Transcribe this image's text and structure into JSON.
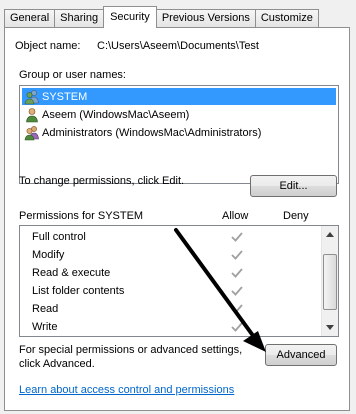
{
  "tabs": [
    "General",
    "Sharing",
    "Security",
    "Previous Versions",
    "Customize"
  ],
  "active_tab": "Security",
  "object": {
    "label": "Object name:",
    "value": "C:\\Users\\Aseem\\Documents\\Test"
  },
  "groups": {
    "label": "Group or user names:",
    "items": [
      {
        "label": "SYSTEM",
        "icon": "users-icon",
        "selected": true
      },
      {
        "label": "Aseem (WindowsMac\\Aseem)",
        "icon": "user-icon",
        "selected": false
      },
      {
        "label": "Administrators (WindowsMac\\Administrators)",
        "icon": "users-icon",
        "selected": false
      }
    ]
  },
  "change_text": "To change permissions, click Edit.",
  "edit_label": "Edit...",
  "permissions": {
    "title": "Permissions for SYSTEM",
    "allow_header": "Allow",
    "deny_header": "Deny",
    "rows": [
      {
        "name": "Full control",
        "allow": true,
        "deny": false
      },
      {
        "name": "Modify",
        "allow": true,
        "deny": false
      },
      {
        "name": "Read & execute",
        "allow": true,
        "deny": false
      },
      {
        "name": "List folder contents",
        "allow": true,
        "deny": false
      },
      {
        "name": "Read",
        "allow": true,
        "deny": false
      },
      {
        "name": "Write",
        "allow": true,
        "deny": false
      }
    ]
  },
  "special_text_1": "For special permissions or advanced settings,",
  "special_text_2": "click Advanced.",
  "advanced_label": "Advanced",
  "learn_link": "Learn about access control and permissions",
  "colors": {
    "selection": "#3399ff",
    "link": "#0066cc",
    "check": "#a0a0a0",
    "annotation_arrow": "#000000"
  }
}
